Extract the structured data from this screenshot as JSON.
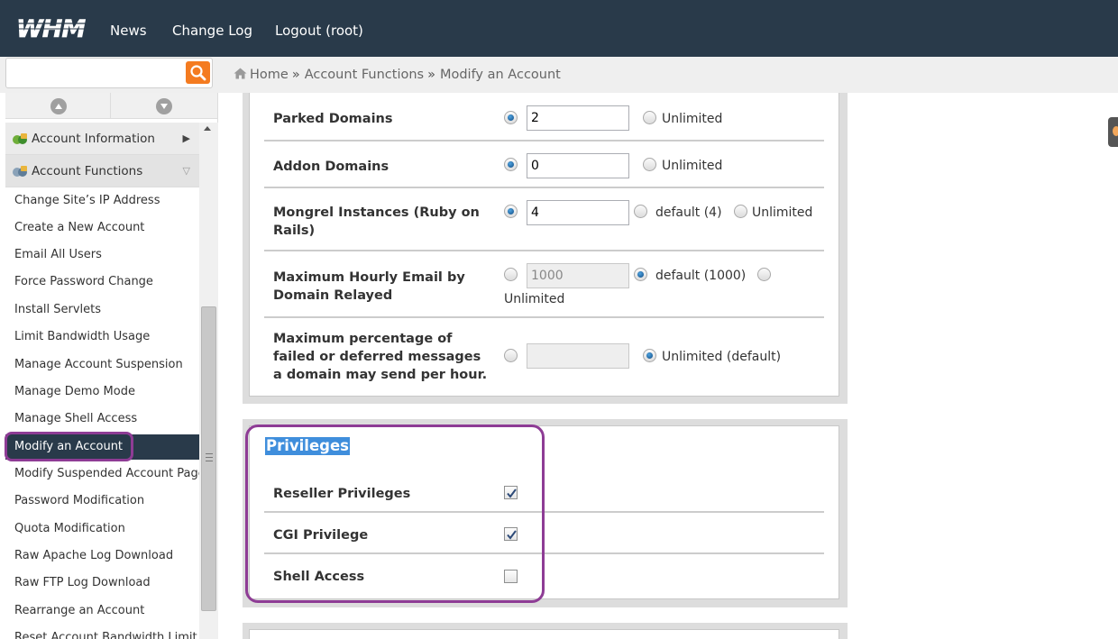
{
  "app": {
    "logo_text": "WHM"
  },
  "topnav": [
    {
      "label": "News"
    },
    {
      "label": "Change Log"
    },
    {
      "label": "Logout (root)"
    }
  ],
  "search": {
    "value": "",
    "placeholder": ""
  },
  "breadcrumb": {
    "items": [
      "Home",
      "Account Functions",
      "Modify an Account"
    ],
    "separator": "»"
  },
  "sidebar": {
    "categories": [
      {
        "label": "Account Information",
        "arrow": "▶"
      },
      {
        "label": "Account Functions",
        "arrow": "▽"
      }
    ],
    "items": [
      "Change Site’s IP Address",
      "Create a New Account",
      "Email All Users",
      "Force Password Change",
      "Install Servlets",
      "Limit Bandwidth Usage",
      "Manage Account Suspension",
      "Manage Demo Mode",
      "Manage Shell Access",
      "Modify an Account",
      "Modify Suspended Account Page",
      "Password Modification",
      "Quota Modification",
      "Raw Apache Log Download",
      "Raw FTP Log Download",
      "Rearrange an Account",
      "Reset Account Bandwidth Limit"
    ],
    "active_item": "Modify an Account"
  },
  "limits": {
    "parked": {
      "label": "Parked Domains",
      "value": "2",
      "unlimited_label": "Unlimited",
      "selected": "value"
    },
    "addon": {
      "label": "Addon Domains",
      "value": "0",
      "unlimited_label": "Unlimited",
      "selected": "value"
    },
    "mongrel": {
      "label": "Mongrel Instances (Ruby on Rails)",
      "value": "4",
      "default_label": "default (4)",
      "unlimited_label": "Unlimited",
      "selected": "value"
    },
    "hourly_email": {
      "label": "Maximum Hourly Email by Domain Relayed",
      "value": "1000",
      "default_label": "default (1000)",
      "unlimited_label": "Unlimited",
      "selected": "default"
    },
    "failed_pct": {
      "label": "Maximum percentage of failed or deferred messages a domain may send per hour.",
      "value": "",
      "unlimited_label": "Unlimited (default)",
      "selected": "unlimited"
    }
  },
  "privileges": {
    "title": "Privileges",
    "items": [
      {
        "label": "Reseller Privileges",
        "checked": true
      },
      {
        "label": "CGI Privilege",
        "checked": true
      },
      {
        "label": "Shell Access",
        "checked": false
      }
    ]
  },
  "colors": {
    "topbar": "#293a4a",
    "accent_orange": "#f47b20",
    "highlight_purple": "#8e3c95",
    "selection_blue": "#3f8edc"
  }
}
